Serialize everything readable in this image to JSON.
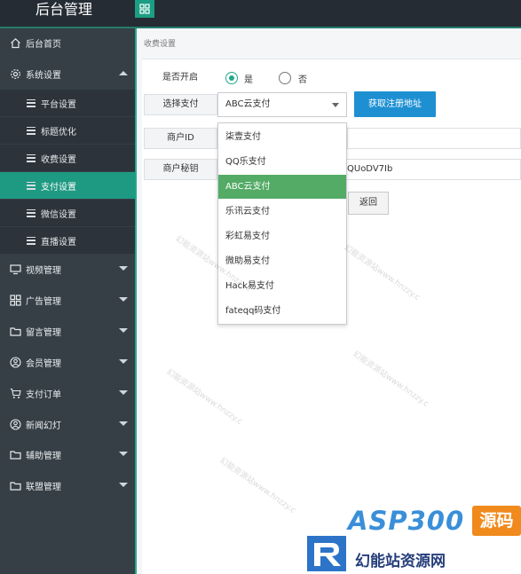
{
  "header": {
    "brand": "后台管理"
  },
  "sidebar": {
    "items": [
      {
        "label": "后台首页"
      },
      {
        "label": "系统设置"
      },
      {
        "label": "视频管理"
      },
      {
        "label": "广告管理"
      },
      {
        "label": "留言管理"
      },
      {
        "label": "会员管理"
      },
      {
        "label": "支付订单"
      },
      {
        "label": "新闻幻灯"
      },
      {
        "label": "辅助管理"
      },
      {
        "label": "联盟管理"
      }
    ],
    "system_sub": [
      {
        "label": "平台设置"
      },
      {
        "label": "标题优化"
      },
      {
        "label": "收费设置"
      },
      {
        "label": "支付设置"
      },
      {
        "label": "微信设置"
      },
      {
        "label": "直播设置"
      }
    ]
  },
  "breadcrumb": "收费设置",
  "form": {
    "enable_label": "是否开启",
    "yes": "是",
    "no": "否",
    "pay_label": "选择支付",
    "pay_selected": "ABC云支付",
    "get_url_button": "获取注册地址",
    "merchant_id_label": "商户ID",
    "merchant_key_label": "商户秘钥",
    "merchant_key_value": "QUoDV7Ib",
    "back_button": "返回"
  },
  "dropdown": {
    "options": [
      "柒壹支付",
      "QQ乐支付",
      "ABC云支付",
      "乐讯云支付",
      "彩虹易支付",
      "微助易支付",
      "Hack易支付",
      "fateqq码支付"
    ]
  },
  "watermark": {
    "text": "幻能资源站www.hnzzy.c",
    "logo_main": "ASP300",
    "logo_tag": "源码",
    "logo_sub": "幻能站资源网"
  },
  "colors": {
    "accent": "#22a88a",
    "sidebar": "#363f46",
    "primary_button": "#1e90d2",
    "dropdown_active": "#53ab66"
  }
}
